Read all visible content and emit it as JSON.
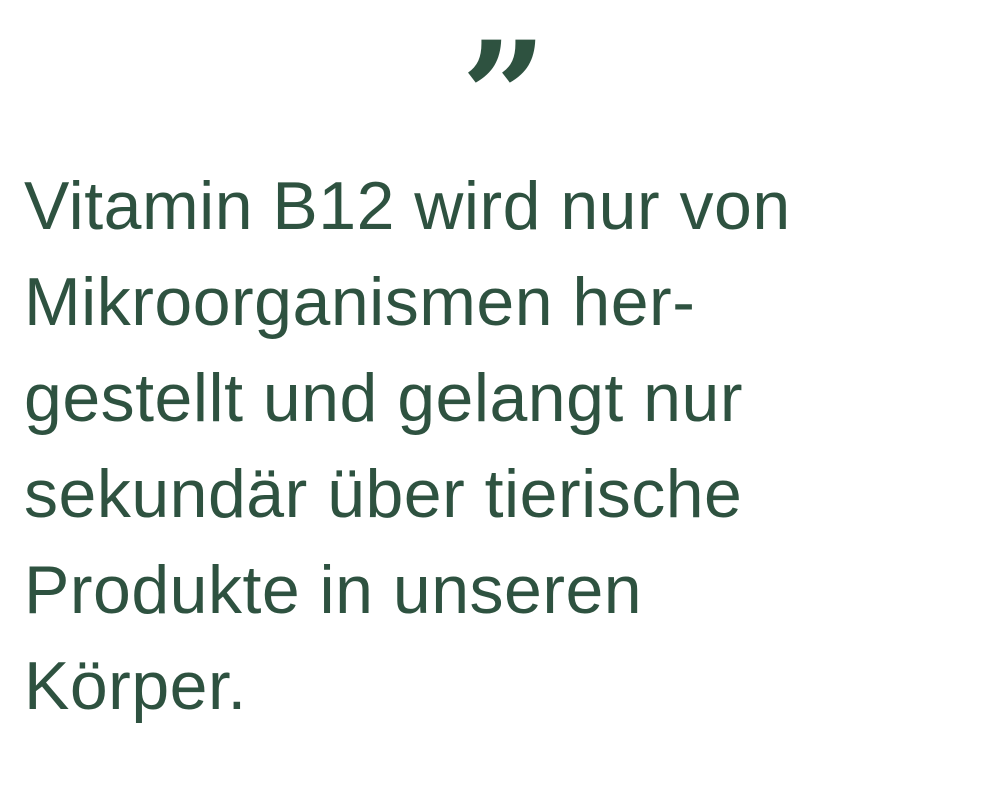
{
  "quote": {
    "mark": "”",
    "lines": [
      "Vitamin B12 wird nur von",
      "Mikroorganismen her-",
      "gestellt und gelangt nur",
      "sekundär über tierische",
      "Produkte in unseren",
      "Körper."
    ]
  },
  "colors": {
    "text": "#2e5240",
    "background": "#ffffff"
  }
}
